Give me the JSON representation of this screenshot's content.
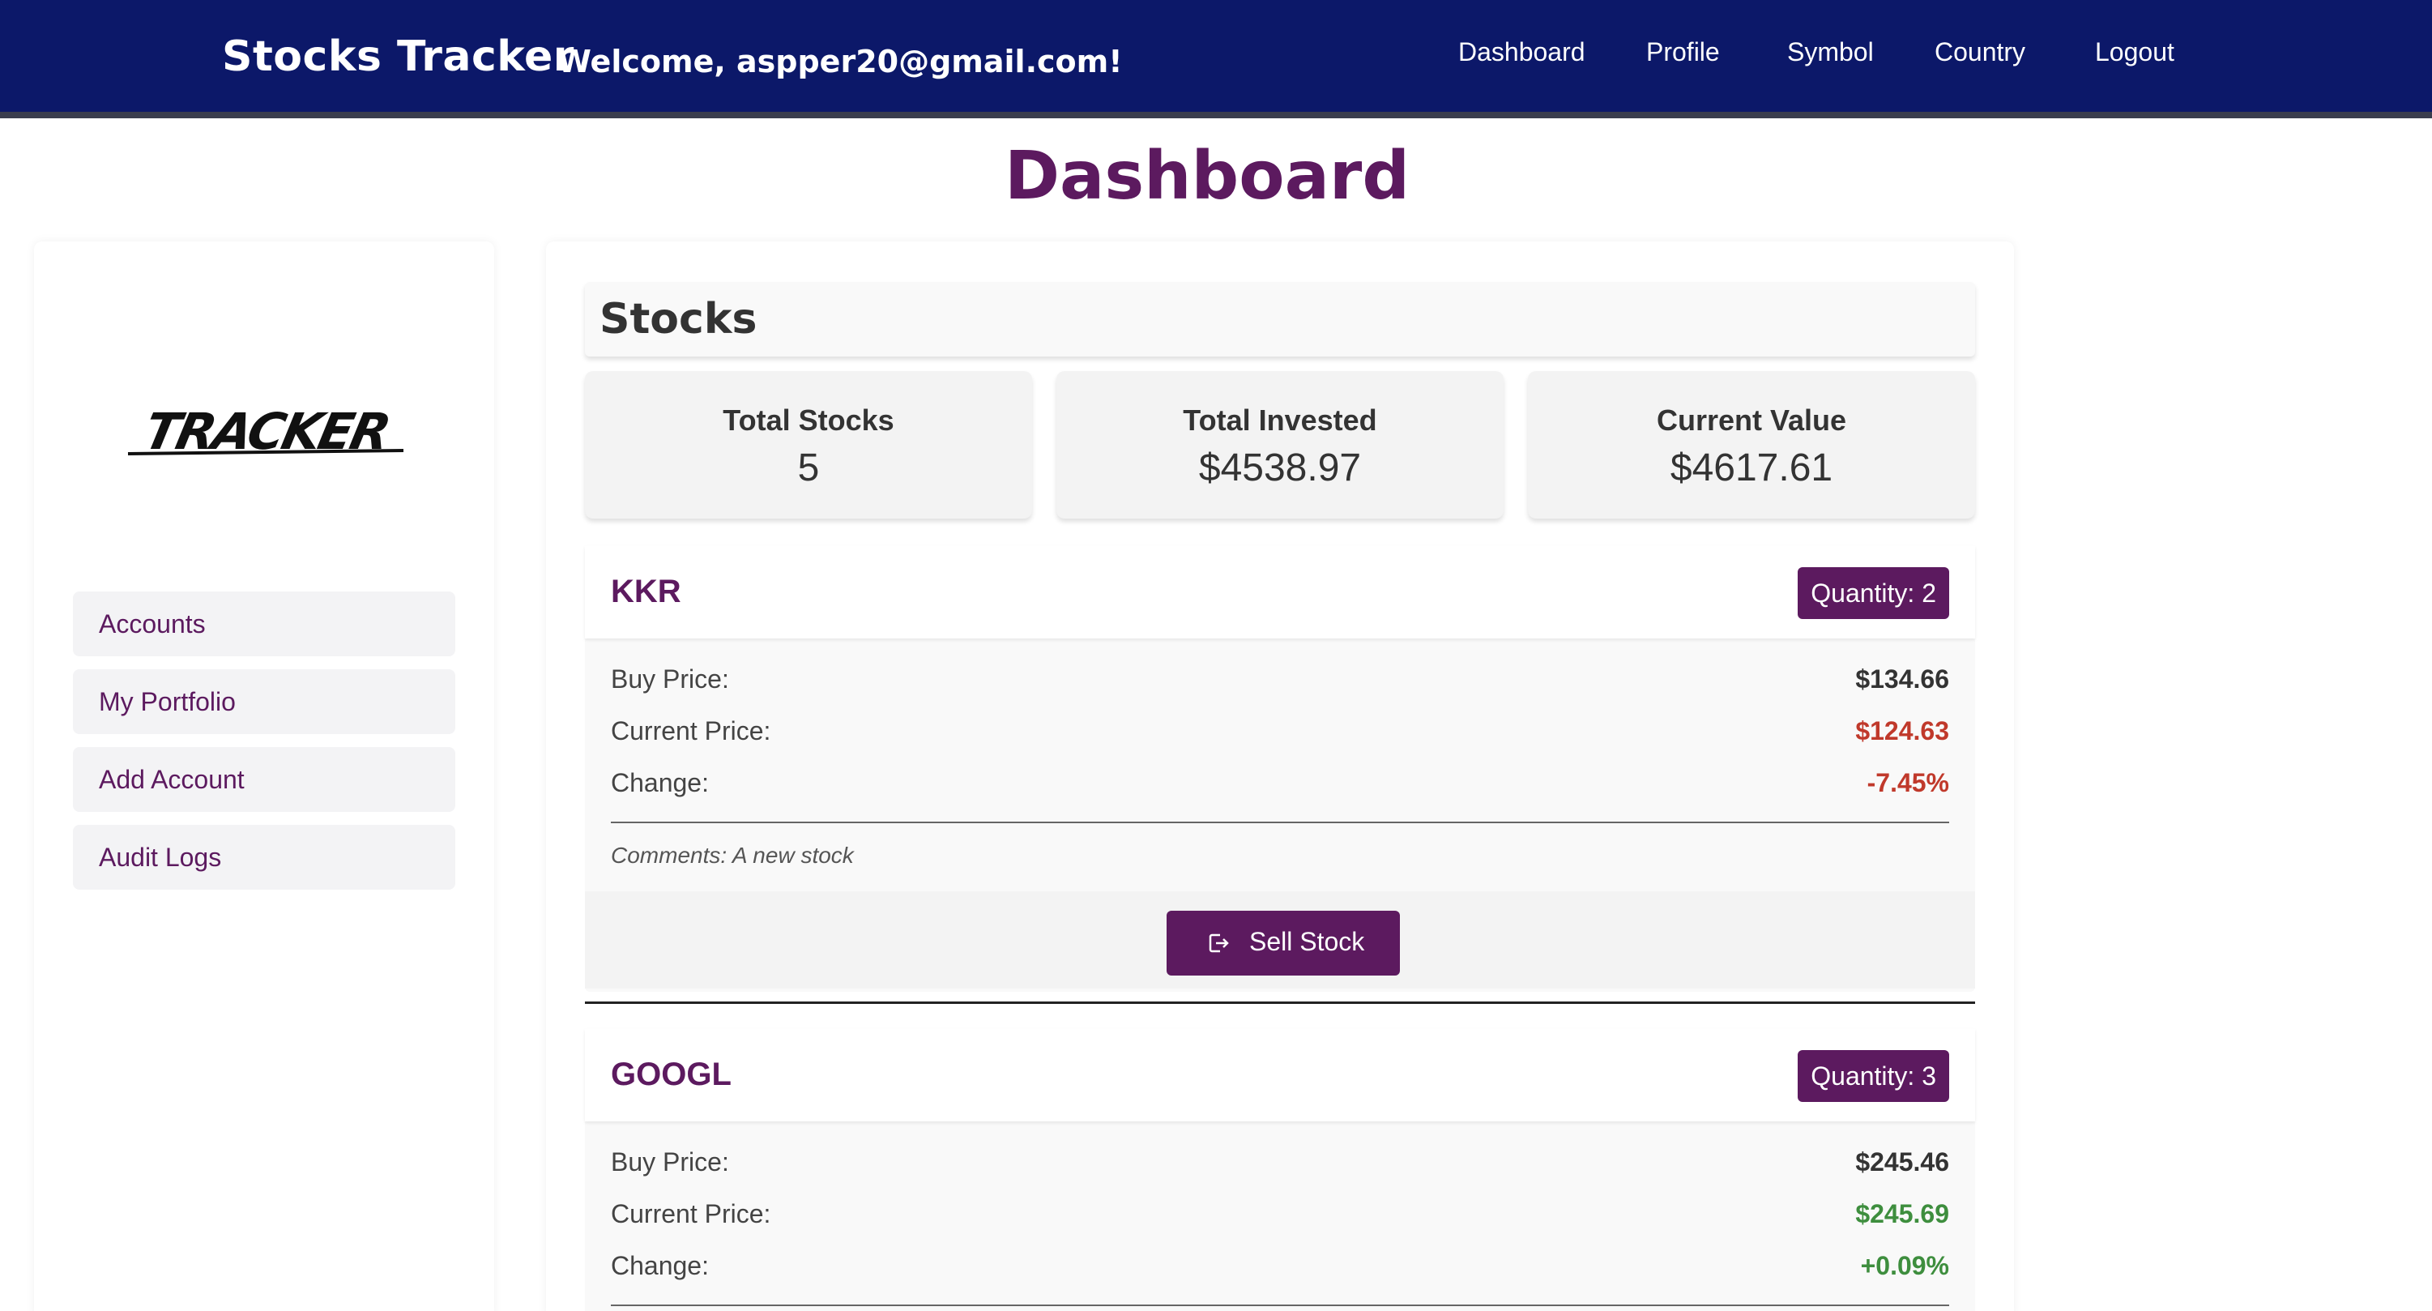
{
  "navbar": {
    "brand": "Stocks Tracker",
    "welcome": "Welcome, aspper20@gmail.com!",
    "links": [
      "Dashboard",
      "Profile",
      "Symbol",
      "Country",
      "Logout"
    ]
  },
  "page_title": "Dashboard",
  "sidebar": {
    "logo_text": "TRACKER",
    "items": [
      "Accounts",
      "My Portfolio",
      "Add Account",
      "Audit Logs"
    ]
  },
  "stocks": {
    "header": "Stocks",
    "summary": {
      "total_stocks_label": "Total Stocks",
      "total_stocks_value": "5",
      "total_invested_label": "Total Invested",
      "total_invested_value": "$4538.97",
      "current_value_label": "Current Value",
      "current_value_value": "$4617.61"
    },
    "labels": {
      "buy_price": "Buy Price:",
      "current_price": "Current Price:",
      "change": "Change:",
      "sell": "Sell Stock"
    },
    "items": [
      {
        "symbol": "KKR",
        "quantity": "Quantity: 2",
        "buy_price": "$134.66",
        "current_price": "$124.63",
        "change": "-7.45%",
        "comments": "Comments: A new stock"
      },
      {
        "symbol": "GOOGL",
        "quantity": "Quantity: 3",
        "buy_price": "$245.46",
        "current_price": "$245.69",
        "change": "+0.09%"
      }
    ]
  },
  "colors": {
    "navbar": "#0c1869",
    "accent": "#5c1a5f",
    "negative": "#c0392b",
    "positive": "#3e8e3e"
  }
}
